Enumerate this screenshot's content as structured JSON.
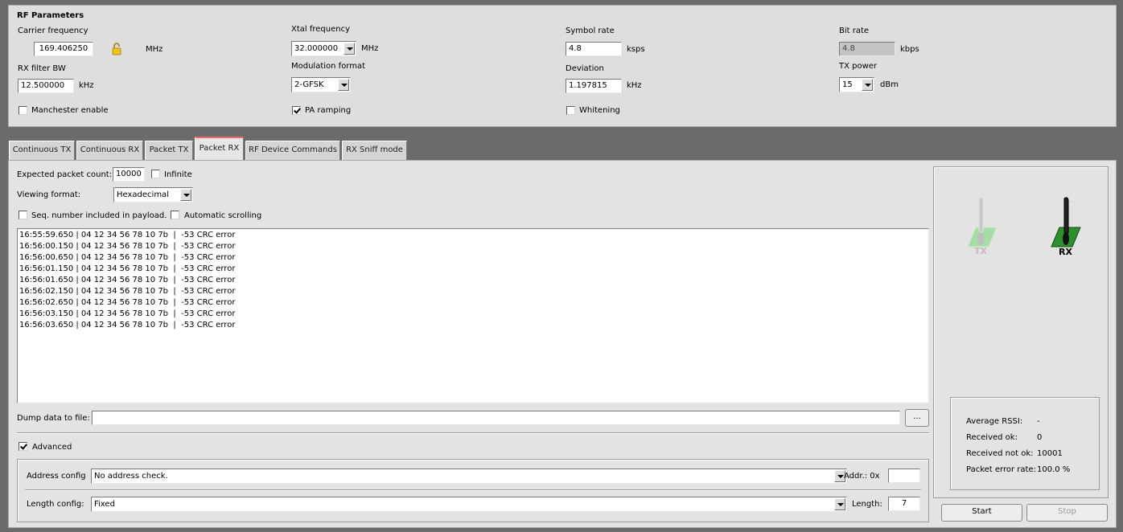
{
  "rf": {
    "title": "RF Parameters",
    "carrier_label": "Carrier frequency",
    "carrier_value": "169.406250",
    "carrier_unit": "MHz",
    "rxbw_label": "RX filter BW",
    "rxbw_value": "12.500000",
    "rxbw_unit": "kHz",
    "manchester_label": "Manchester enable",
    "xtal_label": "Xtal frequency",
    "xtal_value": "32.000000",
    "xtal_unit": "MHz",
    "modfmt_label": "Modulation format",
    "modfmt_value": "2-GFSK",
    "pa_label": "PA ramping",
    "symrate_label": "Symbol rate",
    "symrate_value": "4.8",
    "symrate_unit": "ksps",
    "deviation_label": "Deviation",
    "deviation_value": "1.197815",
    "deviation_unit": "kHz",
    "whitening_label": "Whitening",
    "bitrate_label": "Bit rate",
    "bitrate_value": "4.8",
    "bitrate_unit": "kbps",
    "txpower_label": "TX power",
    "txpower_value": "15",
    "txpower_unit": "dBm",
    "manchester_checked": false,
    "pa_checked": true,
    "whitening_checked": false
  },
  "tabs": [
    {
      "label": "Continuous TX"
    },
    {
      "label": "Continuous RX"
    },
    {
      "label": "Packet TX"
    },
    {
      "label": "Packet RX"
    },
    {
      "label": "RF Device Commands"
    },
    {
      "label": "RX Sniff mode"
    }
  ],
  "active_tab": "Packet RX",
  "packet_rx": {
    "expected_label": "Expected packet count:",
    "expected_value": "10000",
    "infinite_label": "Infinite",
    "viewing_label": "Viewing format:",
    "viewing_value": "Hexadecimal",
    "seq_label": "Seq. number included in payload.",
    "autoscroll_label": "Automatic scrolling",
    "log": [
      "16:55:59.650 | 04 12 34 56 78 10 7b  |  -53 CRC error",
      "16:56:00.150 | 04 12 34 56 78 10 7b  |  -53 CRC error",
      "16:56:00.650 | 04 12 34 56 78 10 7b  |  -53 CRC error",
      "16:56:01.150 | 04 12 34 56 78 10 7b  |  -53 CRC error",
      "16:56:01.650 | 04 12 34 56 78 10 7b  |  -53 CRC error",
      "16:56:02.150 | 04 12 34 56 78 10 7b  |  -53 CRC error",
      "16:56:02.650 | 04 12 34 56 78 10 7b  |  -53 CRC error",
      "16:56:03.150 | 04 12 34 56 78 10 7b  |  -53 CRC error",
      "16:56:03.650 | 04 12 34 56 78 10 7b  |  -53 CRC error"
    ],
    "dump_label": "Dump data to file:",
    "dump_value": "",
    "browse_label": "...",
    "advanced_label": "Advanced",
    "address_label": "Address config",
    "address_value": "No address check.",
    "addr_label": "Addr.:  0x",
    "addr_value": "",
    "length_label": "Length config:",
    "length_value": "Fixed",
    "length_field_label": "Length:",
    "length_field_value": "7",
    "advanced_checked": true,
    "infinite_checked": false,
    "seq_checked": false,
    "autoscroll_checked": false
  },
  "status": {
    "tx_label": "TX",
    "rx_label": "RX",
    "avg_rssi_label": "Average RSSI:",
    "avg_rssi_value": "-",
    "received_ok_label": "Received ok:",
    "received_ok_value": "0",
    "received_not_ok_label": "Received not ok:",
    "received_not_ok_value": "10001",
    "per_label": "Packet error rate:",
    "per_value": "100.0 %",
    "start_label": "Start",
    "stop_label": "Stop"
  },
  "colors": {
    "window_bg": "#6b6b6b",
    "panel_bg": "#dedede",
    "active_tab_accent": "#e86a6a",
    "tx_switch_green": "#9bd69b",
    "rx_switch_green": "#2e8b2e"
  }
}
